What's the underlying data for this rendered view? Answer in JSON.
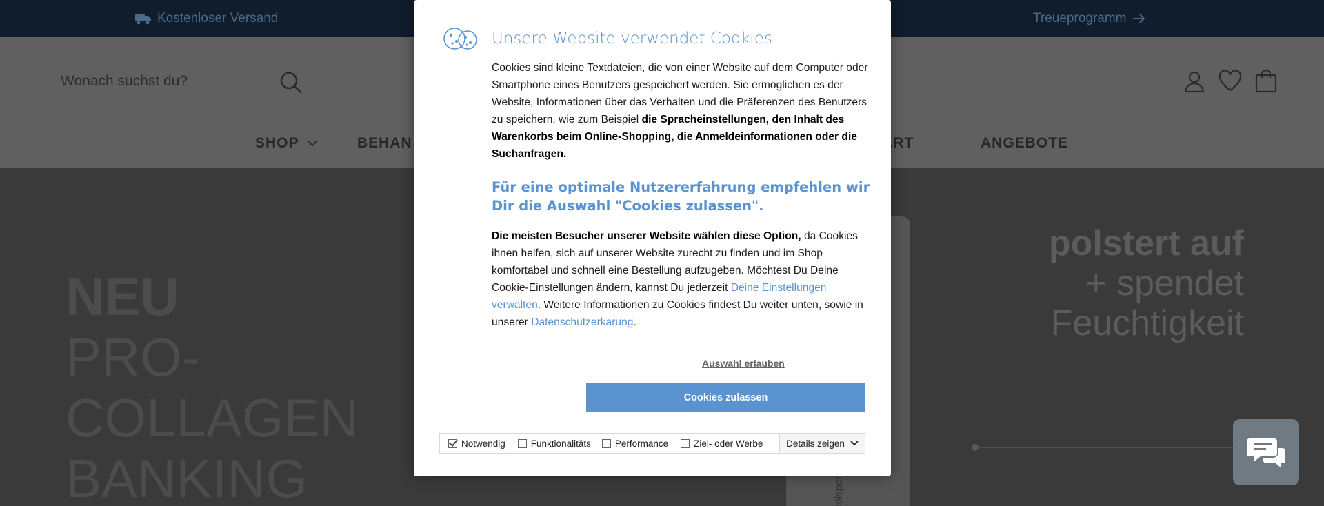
{
  "topbar": {
    "shipping": "Kostenloser Versand",
    "loyalty": "Treueprogramm"
  },
  "header": {
    "search_placeholder": "Wonach suchst du?"
  },
  "nav": {
    "shop": "SHOP",
    "behandlungen": "BEHAN",
    "start": "START",
    "angebote": "ANGEBOTE"
  },
  "hero": {
    "left_bold": "NEU",
    "left_lines": [
      "PRO-",
      "COLLAGEN",
      "BANKING"
    ],
    "right_bold": "polstert auf",
    "right_lines": [
      "+ spendet",
      "Feuchtigkeit"
    ],
    "product_label": "polspen"
  },
  "modal": {
    "title": "Unsere Website verwendet Cookies",
    "intro_text": "Cookies sind kleine Textdateien, die von einer Website auf dem Computer oder Smartphone eines Benutzers gespeichert werden. Sie ermöglichen es der Website, Informationen über das Verhalten und die Präferenzen des Benutzers zu speichern, wie zum Beispiel ",
    "intro_bold": "die Spracheinstellungen, den Inhalt des Warenkorbs beim Online-Shopping, die Anmeldeinformationen oder die Suchanfragen.",
    "recommend": "Für eine optimale Nutzererfahrung empfehlen wir Dir die Auswahl \"Cookies zulassen\".",
    "most_bold": "Die meisten Besucher unserer Website wählen diese Option,",
    "most_text": " da Cookies ihnen helfen, sich auf unserer Website zurecht zu finden und im Shop komfortabel und schnell eine Bestellung aufzugeben. Möchtest Du Deine Cookie-Einstellungen ändern, kannst Du jederzeit ",
    "link_settings": "Deine Einstellungen verwalten",
    "more_text": ". Weitere Informationen zu Cookies findest Du weiter unten, sowie in unserer ",
    "link_privacy": "Datenschutzerkärung",
    "end_text": ".",
    "allow_selection": "Auswahl erlauben",
    "allow_all": "Cookies zulassen",
    "categories": [
      {
        "label": "Notwendig",
        "checked": true
      },
      {
        "label": "Funktionalitäts",
        "checked": false
      },
      {
        "label": "Performance",
        "checked": false
      },
      {
        "label": "Ziel- oder Werbe",
        "checked": false
      }
    ],
    "details": "Details zeigen"
  },
  "colors": {
    "accent": "#5b93d1",
    "topbar": "#0f1d2c",
    "overlay_header": "#606060",
    "hero_bg": "#3a3a3a"
  }
}
